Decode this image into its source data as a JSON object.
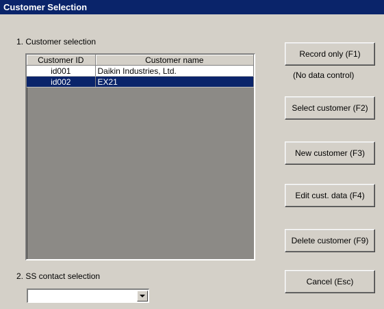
{
  "window": {
    "title": "Customer Selection"
  },
  "section1": {
    "label": "1. Customer selection"
  },
  "grid": {
    "headers": {
      "customer_id": "Customer ID",
      "customer_name": "Customer name"
    },
    "rows": [
      {
        "customer_id": "id001",
        "customer_name": "Daikin Industries, Ltd.",
        "selected": false
      },
      {
        "customer_id": "id002",
        "customer_name": "EX21",
        "selected": true
      }
    ]
  },
  "buttons": {
    "record_only": "Record only (F1)",
    "select_customer": "Select customer (F2)",
    "new_customer": "New customer (F3)",
    "edit_customer": "Edit cust. data (F4)",
    "delete_customer": "Delete customer (F9)",
    "cancel": "Cancel (Esc)"
  },
  "note": {
    "no_data_control": "(No data control)"
  },
  "section2": {
    "label": "2. SS contact selection"
  },
  "ss_contact": {
    "value": ""
  },
  "colors": {
    "title_bar": "#0a246a",
    "selection": "#0a246a",
    "window_bg": "#d4d0c8"
  }
}
